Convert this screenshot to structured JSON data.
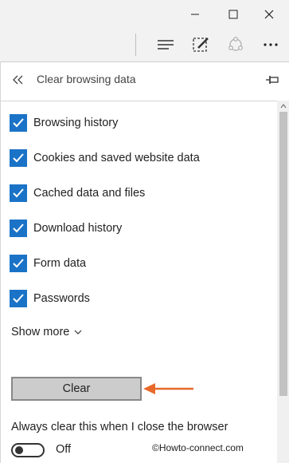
{
  "window": {
    "minimize_icon": "minimize-icon",
    "maximize_icon": "maximize-icon",
    "close_icon": "close-icon"
  },
  "toolbar": {
    "hub_icon": "hub-icon",
    "web_note_icon": "web-note-icon",
    "share_icon": "share-icon",
    "more_icon": "more-icon"
  },
  "panel": {
    "title": "Clear browsing data",
    "back_icon": "back-chevron-icon",
    "pin_icon": "pin-icon",
    "items": [
      {
        "label": "Browsing history",
        "checked": true
      },
      {
        "label": "Cookies and saved website data",
        "checked": true
      },
      {
        "label": "Cached data and files",
        "checked": true
      },
      {
        "label": "Download history",
        "checked": true
      },
      {
        "label": "Form data",
        "checked": true
      },
      {
        "label": "Passwords",
        "checked": true
      }
    ],
    "show_more_label": "Show more",
    "clear_button_label": "Clear",
    "always_clear_label": "Always clear this when I close the browser",
    "toggle_state_label": "Off",
    "toggle_on": false
  },
  "watermark": "©Howto-connect.com",
  "colors": {
    "accent": "#1a73c7",
    "annotation_arrow": "#e8692a"
  }
}
